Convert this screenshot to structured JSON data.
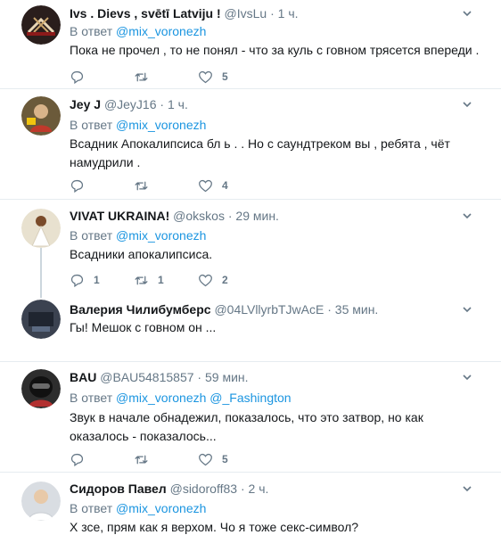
{
  "reply_prefix": "В ответ",
  "tweets": [
    {
      "name": "Ivs . Dievs , svētī Latviju !",
      "handle": "@IvsLu",
      "time": "1 ч.",
      "reply_to": "@mix_voronezh",
      "text": "Пока не прочел , то не понял - что за куль с говном трясется впереди .",
      "replies": "",
      "retweets": "",
      "likes": "5"
    },
    {
      "name": "Jey J",
      "handle": "@JeyJ16",
      "time": "1 ч.",
      "reply_to": "@mix_voronezh",
      "text": "Всадник Апокалипсиса бл  ь . .  Но с саундтреком вы , ребята , чёт намудрили .",
      "replies": "",
      "retweets": "",
      "likes": "4"
    },
    {
      "name": "VIVAT UKRAINA!",
      "handle": "@okskos",
      "time": "29 мин.",
      "reply_to": "@mix_voronezh",
      "text": "Всадники апокалипсиса.",
      "replies": "1",
      "retweets": "1",
      "likes": "2"
    },
    {
      "name": "Валерия Чилибумберс",
      "handle": "@04LVllyrbTJwAcE",
      "time": "35 мин.",
      "text": "Гы! Мешок с говном он ..."
    },
    {
      "name": "BAU",
      "handle": "@BAU54815857",
      "time": "59 мин.",
      "reply_to": "@mix_voronezh",
      "reply_to_2": "@_Fashington",
      "text": "Звук в начале обнадежил, показалось, что это затвор, но как оказалось - показалось...",
      "replies": "",
      "retweets": "",
      "likes": "5"
    },
    {
      "name": "Сидоров Павел",
      "handle": "@sidoroff83",
      "time": "2 ч.",
      "reply_to": "@mix_voronezh",
      "text": "Х  зсе, прям как я верхом. Чо я тоже секс-символ?"
    }
  ],
  "colors": {
    "text": "#14171a",
    "muted": "#657786",
    "link": "#1b95e0",
    "divider": "#e6ecf0",
    "thread_line": "#ccd6dd"
  },
  "icons": [
    "chevron-down-icon",
    "reply-icon",
    "retweet-icon",
    "like-icon"
  ]
}
